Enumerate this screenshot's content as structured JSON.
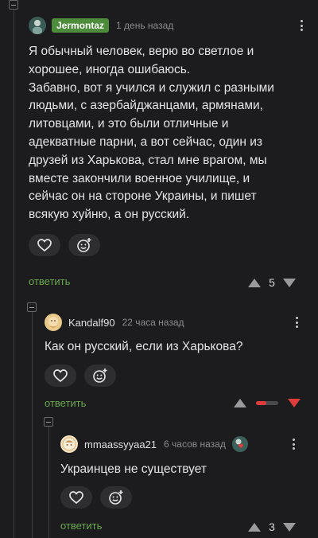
{
  "comments": [
    {
      "username": "Jermontaz",
      "time": "1 день назад",
      "text": "Я обычный человек, верю во светлое и\nхорошее, иногда ошибаюсь.\nЗабавно, вот я учился и служил с разными\nлюдьми, с азербайджанцами, армянами,\nлитовцами, и это были отличные и\nадекватные парни, а вот сейчас, один из\nдрузей из Харькова, стал мне врагом, мы\nвместе закончили военное училище, и\nсейчас он на стороне Украины, и пишет\nвсякую хуйню, а он русский.",
      "reply_label": "ответить",
      "rating": "5"
    },
    {
      "username": "Kandalf90",
      "time": "22 часа назад",
      "text": "Как он русский, если из Харькова?",
      "reply_label": "ответить",
      "rating": "",
      "rating_negative_share": 0.45
    },
    {
      "username": "mmaassyyaa21",
      "time": "6 часов назад",
      "text": "Украинцев не существует",
      "reply_label": "ответить",
      "rating": "3"
    }
  ],
  "icons": {
    "like": "heart-icon",
    "emoji": "smile-add-icon",
    "menu": "more-vertical-icon"
  },
  "colors": {
    "background": "#1c1c1e",
    "op_badge": "#4c8c3a",
    "reply": "#6aa84f",
    "negative": "#e03c3c"
  }
}
